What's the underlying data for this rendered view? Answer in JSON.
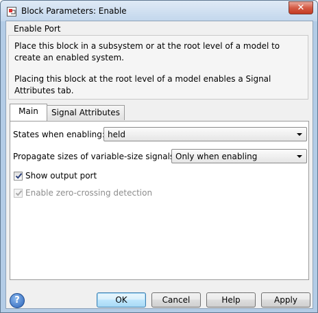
{
  "window": {
    "title": "Block Parameters: Enable",
    "close_glyph": "✕"
  },
  "header": {
    "group_title": "Enable Port",
    "description_1": "Place this block in a subsystem or at the root level of a model to create an enabled system.",
    "description_2": "Placing this block at the root level of a model enables a Signal Attributes tab."
  },
  "tabs": [
    {
      "label": "Main",
      "active": true
    },
    {
      "label": "Signal Attributes",
      "active": false
    }
  ],
  "main": {
    "states_label": "States when enabling:",
    "states_value": "held",
    "propagate_label": "Propagate sizes of variable-size signals:",
    "propagate_value": "Only when enabling",
    "show_output_label": "Show output port",
    "show_output_checked": true,
    "zero_crossing_label": "Enable zero-crossing detection",
    "zero_crossing_checked": true,
    "zero_crossing_enabled": false
  },
  "buttons": {
    "help_icon_glyph": "?",
    "ok": "OK",
    "cancel": "Cancel",
    "help": "Help",
    "apply": "Apply"
  },
  "colors": {
    "window_frame": "#b3cce6",
    "close_button": "#c43a22",
    "default_button": "#3c7fb1"
  },
  "icons": {
    "app": "simulink-block-icon",
    "close": "close-icon",
    "help": "help-icon",
    "dropdown": "chevron-down-icon",
    "check": "check-icon"
  }
}
